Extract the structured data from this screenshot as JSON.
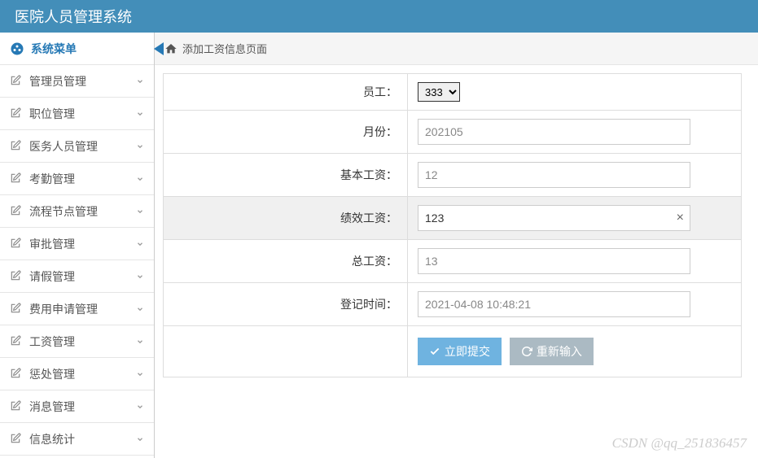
{
  "header": {
    "title": "医院人员管理系统"
  },
  "sidebar": {
    "menu_title": "系统菜单",
    "items": [
      {
        "label": "管理员管理"
      },
      {
        "label": "职位管理"
      },
      {
        "label": "医务人员管理"
      },
      {
        "label": "考勤管理"
      },
      {
        "label": "流程节点管理"
      },
      {
        "label": "审批管理"
      },
      {
        "label": "请假管理"
      },
      {
        "label": "费用申请管理"
      },
      {
        "label": "工资管理"
      },
      {
        "label": "惩处管理"
      },
      {
        "label": "消息管理"
      },
      {
        "label": "信息统计"
      }
    ]
  },
  "breadcrumb": {
    "title": "添加工资信息页面"
  },
  "form": {
    "employee_label": "员工：",
    "employee_value": "333",
    "month_label": "月份：",
    "month_value": "202105",
    "base_salary_label": "基本工资：",
    "base_salary_value": "12",
    "perf_salary_label": "绩效工资：",
    "perf_salary_value": "123",
    "total_salary_label": "总工资：",
    "total_salary_value": "13",
    "reg_time_label": "登记时间：",
    "reg_time_value": "2021-04-08 10:48:21",
    "submit_label": "立即提交",
    "reset_label": "重新输入"
  },
  "watermark": "CSDN @qq_251836457"
}
